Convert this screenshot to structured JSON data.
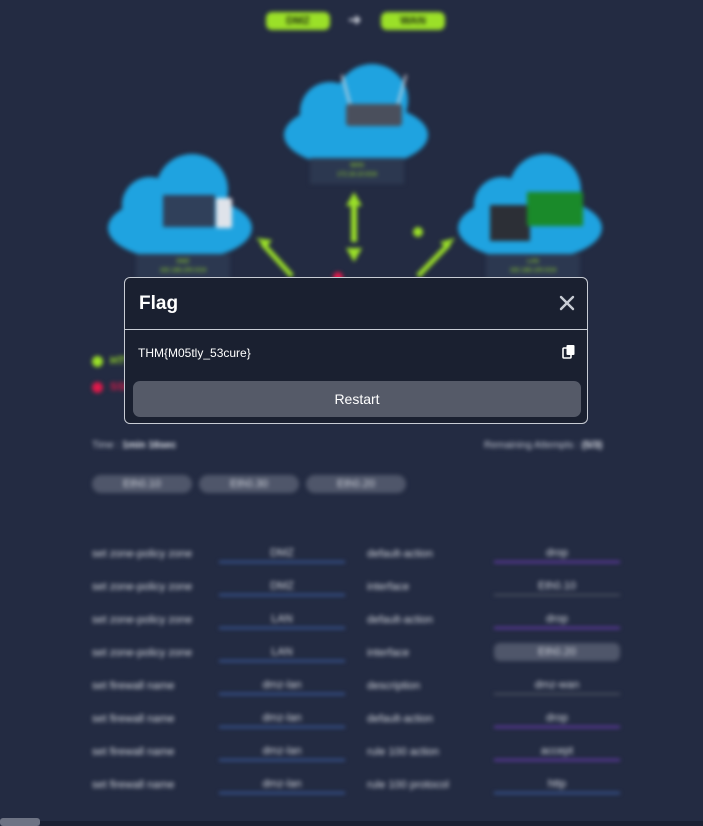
{
  "header": {
    "from_zone": "DMZ",
    "to_zone": "WAN",
    "arrow": "➜"
  },
  "diagram": {
    "wan": {
      "name": "WAN",
      "subnet": "172.16.10.0/24"
    },
    "dmz": {
      "name": "DMZ",
      "subnet": "192.168.200.0/24"
    },
    "lan": {
      "name": "LAN",
      "subnet": "192.168.100.0/24"
    }
  },
  "legend": [
    {
      "text": "HTTP",
      "color": "#9be028"
    },
    {
      "text": "SSH",
      "color": "#e0194a"
    }
  ],
  "status": {
    "time_label": "Time :",
    "time_value": "1min 16sec",
    "attempts_label": "Remaining Attempts :",
    "attempts_value": "(5/3)"
  },
  "interfaces": [
    "Eth0.10",
    "Eth0.30",
    "Eth0.20"
  ],
  "config_rows": [
    {
      "cmd": "set zone-policy zone",
      "arg": "DMZ",
      "param": "default-action",
      "value": "drop"
    },
    {
      "cmd": "set zone-policy zone",
      "arg": "DMZ",
      "param": "interface",
      "value": "Eth0.10"
    },
    {
      "cmd": "set zone-policy zone",
      "arg": "LAN",
      "param": "default-action",
      "value": "drop"
    },
    {
      "cmd": "set zone-policy zone",
      "arg": "LAN",
      "param": "interface",
      "value": "Eth0.20"
    },
    {
      "cmd": "set firewall name",
      "arg": "dmz-lan",
      "param": "description",
      "value": "dmz-wan"
    },
    {
      "cmd": "set firewall name",
      "arg": "dmz-lan",
      "param": "default-action",
      "value": "drop"
    },
    {
      "cmd": "set firewall name",
      "arg": "dmz-lan",
      "param": "rule 100 action",
      "value": "accept"
    },
    {
      "cmd": "set firewall name",
      "arg": "dmz-lan",
      "param": "rule 100 protocol",
      "value": "http"
    }
  ],
  "modal": {
    "title": "Flag",
    "flag": "THM{M05tly_53cure}",
    "restart_label": "Restart",
    "close_icon": "close-icon",
    "copy_icon": "copy-icon"
  },
  "colors": {
    "accent": "#9be028",
    "danger": "#e0194a",
    "bg": "#232b42"
  }
}
